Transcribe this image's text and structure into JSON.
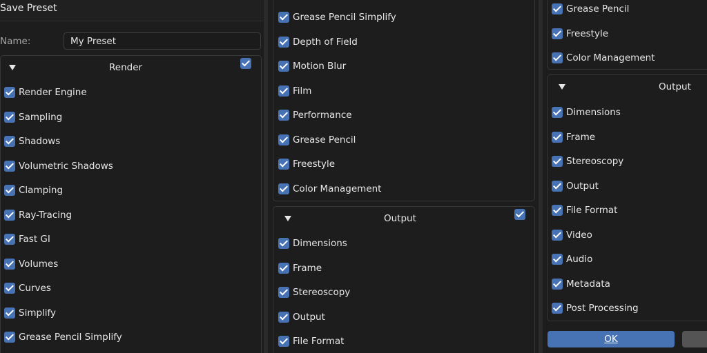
{
  "dialog": {
    "title": "Save Preset",
    "name_label": "Name:",
    "name_value": "My Preset",
    "ok_label": "OK"
  },
  "col1": {
    "render_panel": {
      "title": "Render",
      "items": [
        "Render Engine",
        "Sampling",
        "Shadows",
        "Volumetric Shadows",
        "Clamping",
        "Ray-Tracing",
        "Fast GI",
        "Volumes",
        "Curves",
        "Simplify",
        "Grease Pencil Simplify"
      ]
    }
  },
  "col2": {
    "render_items": [
      "Grease Pencil Simplify",
      "Depth of Field",
      "Motion Blur",
      "Film",
      "Performance",
      "Grease Pencil",
      "Freestyle",
      "Color Management"
    ],
    "output_panel": {
      "title": "Output",
      "items": [
        "Dimensions",
        "Frame",
        "Stereoscopy",
        "Output",
        "File Format"
      ]
    }
  },
  "col3": {
    "render_items": [
      "Grease Pencil",
      "Freestyle",
      "Color Management"
    ],
    "output_panel": {
      "title": "Output",
      "items": [
        "Dimensions",
        "Frame",
        "Stereoscopy",
        "Output",
        "File Format",
        "Video",
        "Audio",
        "Metadata",
        "Post Processing"
      ]
    }
  },
  "colors": {
    "accent": "#4772b3",
    "background": "#1d1d1d",
    "panel_border": "#373737",
    "text": "#e6e6e6"
  }
}
